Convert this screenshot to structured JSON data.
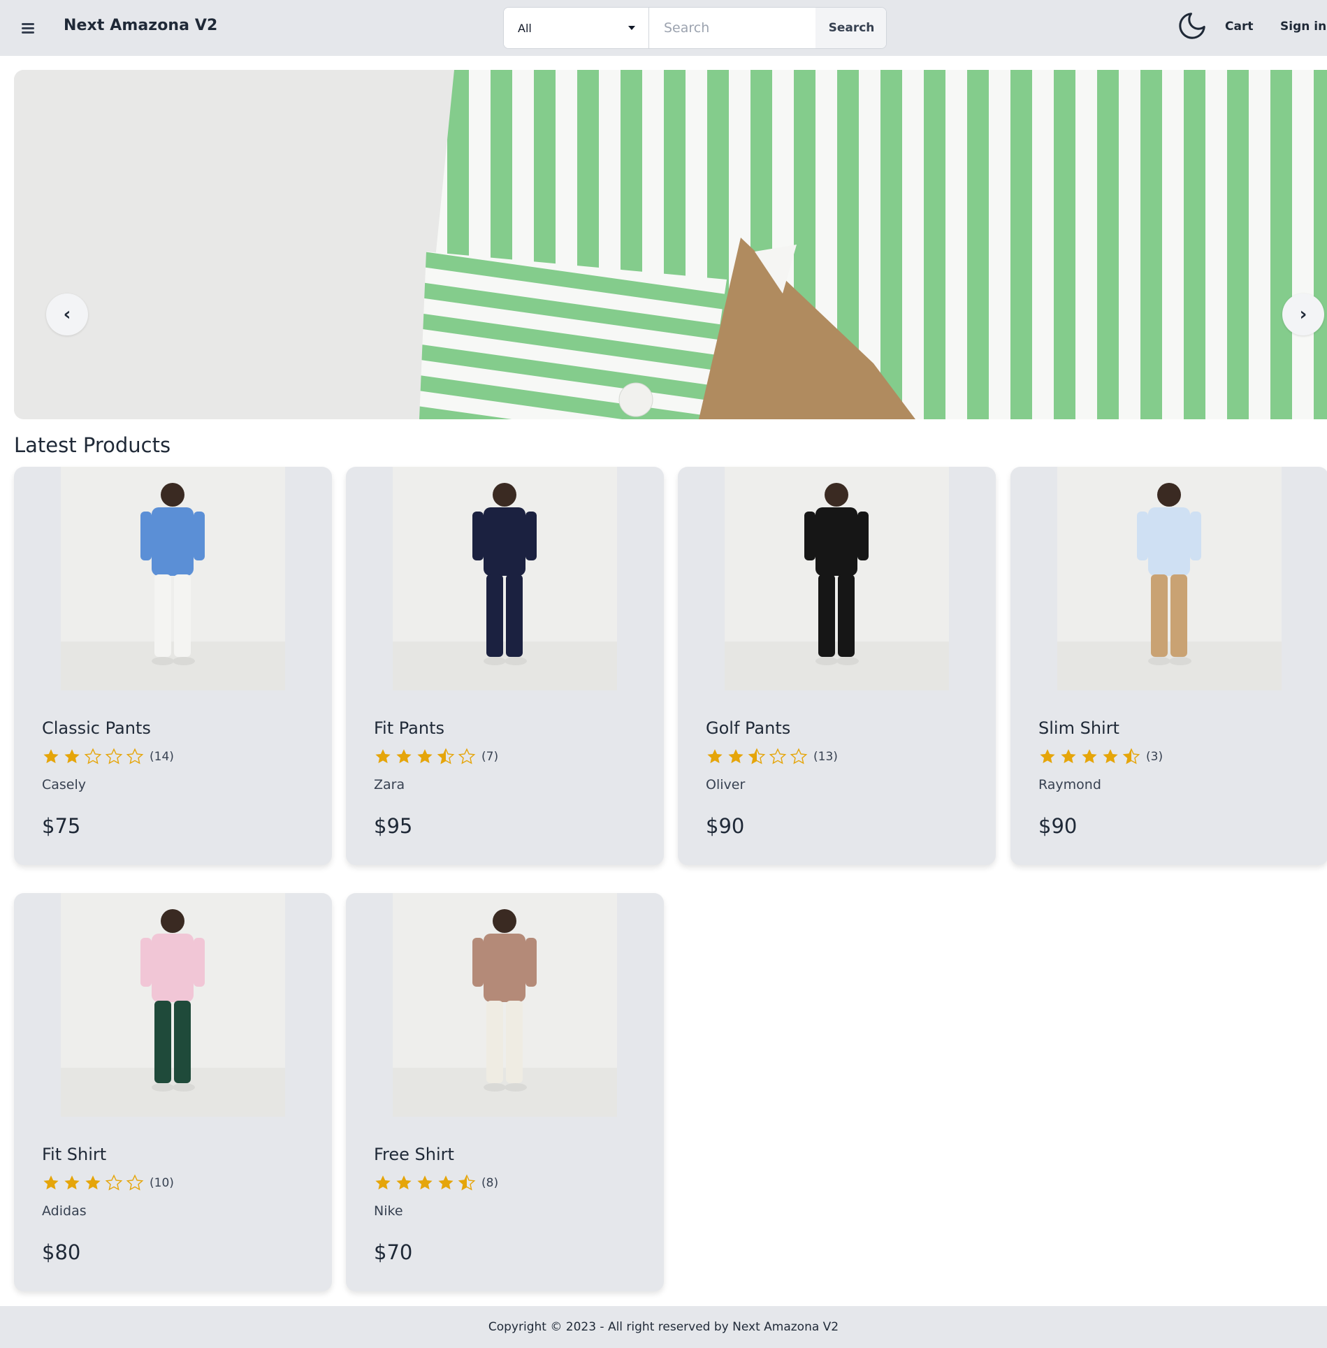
{
  "navbar": {
    "brand": "Next Amazona V2",
    "category": {
      "selected": "All"
    },
    "search": {
      "placeholder": "Search",
      "value": "",
      "button_label": "Search"
    },
    "theme_icon": "moon-icon",
    "cart_label": "Cart",
    "signin_label": "Sign in"
  },
  "carousel": {
    "prev_label": "‹",
    "next_label": "›"
  },
  "products_section": {
    "title": "Latest Products"
  },
  "products": [
    {
      "name": "Classic Pants",
      "rating": 2,
      "reviews": "(14)",
      "brand": "Casely",
      "price": "$75",
      "shirt_color": "#5b8fd6",
      "pants_color": "#f4f4f2"
    },
    {
      "name": "Fit Pants",
      "rating": 3.5,
      "reviews": "(7)",
      "brand": "Zara",
      "price": "$95",
      "shirt_color": "#1b2140",
      "pants_color": "#1b2140"
    },
    {
      "name": "Golf Pants",
      "rating": 2.5,
      "reviews": "(13)",
      "brand": "Oliver",
      "price": "$90",
      "shirt_color": "#161616",
      "pants_color": "#161616"
    },
    {
      "name": "Slim Shirt",
      "rating": 4.5,
      "reviews": "(3)",
      "brand": "Raymond",
      "price": "$90",
      "shirt_color": "#cfe0f3",
      "pants_color": "#c9a273"
    },
    {
      "name": "Fit Shirt",
      "rating": 3,
      "reviews": "(10)",
      "brand": "Adidas",
      "price": "$80",
      "shirt_color": "#f1c6d6",
      "pants_color": "#1f4a3a"
    },
    {
      "name": "Free Shirt",
      "rating": 4.5,
      "reviews": "(8)",
      "brand": "Nike",
      "price": "$70",
      "shirt_color": "#b48a78",
      "pants_color": "#efece3"
    }
  ],
  "footer": {
    "text": "Copyright © 2023 - All right reserved by Next Amazona V2"
  },
  "colors": {
    "star": "#e5a50a",
    "navbar_bg": "#e5e7eb",
    "card_bg": "#e5e7eb"
  }
}
